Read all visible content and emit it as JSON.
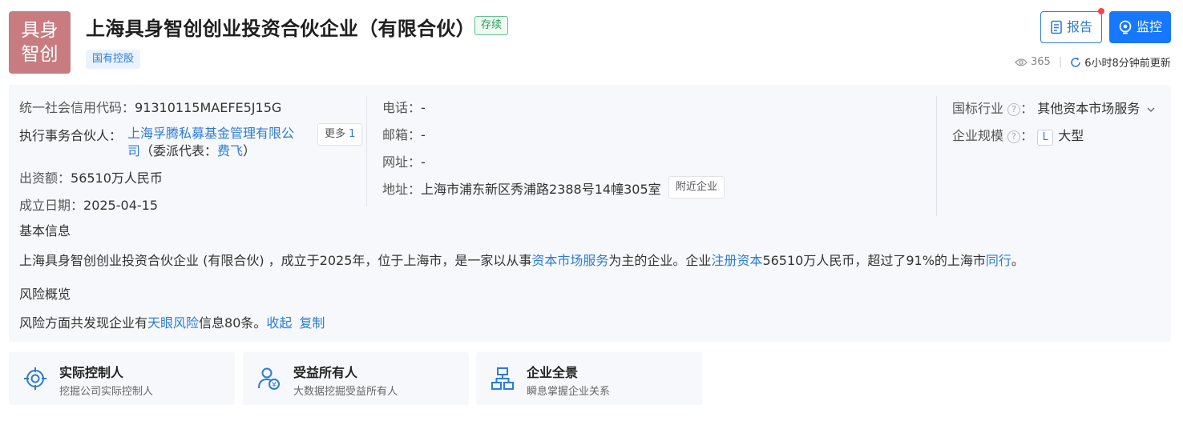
{
  "header": {
    "logo_line1": "具身",
    "logo_line2": "智创",
    "company_name": "上海具身智创创业投资合伙企业（有限合伙）",
    "status": "存续",
    "tag": "国有控股",
    "report_label": "报告",
    "monitor_label": "监控",
    "view_count": "365",
    "update_text": "6小时8分钟前更新"
  },
  "info": {
    "credit_code_label": "统一社会信用代码：",
    "credit_code": "91310115MAEFE5J15G",
    "partner_label": "执行事务合伙人：",
    "partner_name_line1": "上海孚腾私募基金管理有限公",
    "partner_name_line2": "司",
    "partner_rep_prefix": "（委派代表：",
    "partner_rep_name": "费飞",
    "partner_rep_suffix": "）",
    "more_label": "更多",
    "more_count": "1",
    "capital_label": "出资额：",
    "capital": "56510万人民币",
    "date_label": "成立日期：",
    "date": "2025-04-15",
    "phone_label": "电话：",
    "phone": "-",
    "email_label": "邮箱：",
    "email": "-",
    "website_label": "网址：",
    "website": "-",
    "address_label": "地址：",
    "address": "上海市浦东新区秀浦路2388号14幢305室",
    "nearby_label": "附近企业",
    "industry_label": "国标行业",
    "industry": "其他资本市场服务",
    "scale_label": "企业规模",
    "scale_badge": "L",
    "scale": "大型",
    "basic_title": "基本信息",
    "basic_p1": "上海具身智创创业投资合伙企业 (有限合伙) ，成立于2025年，位于上海市，是一家以从事",
    "basic_link1": "资本市场服务",
    "basic_p2": "为主的企业。企业",
    "basic_link2": "注册资本",
    "basic_p3": "56510万人民币，超过了91%的上海市",
    "basic_link3": "同行",
    "basic_p4": "。",
    "risk_title": "风险概览",
    "risk_p1": "风险方面共发现企业有",
    "risk_link": "天眼风险",
    "risk_p2": "信息80条。",
    "collapse_label": "收起",
    "copy_label": "复制"
  },
  "cards": [
    {
      "title": "实际控制人",
      "subtitle": "挖掘公司实际控制人",
      "icon": "target-icon"
    },
    {
      "title": "受益所有人",
      "subtitle": "大数据挖掘受益所有人",
      "icon": "beneficiary-icon"
    },
    {
      "title": "企业全景",
      "subtitle": "瞬息掌握企业关系",
      "icon": "org-chart-icon"
    }
  ],
  "colors": {
    "accent": "#2d7bd8",
    "primary_button": "#1677ff",
    "logo_bg": "#c97c80",
    "status_green": "#2e9a5b"
  }
}
